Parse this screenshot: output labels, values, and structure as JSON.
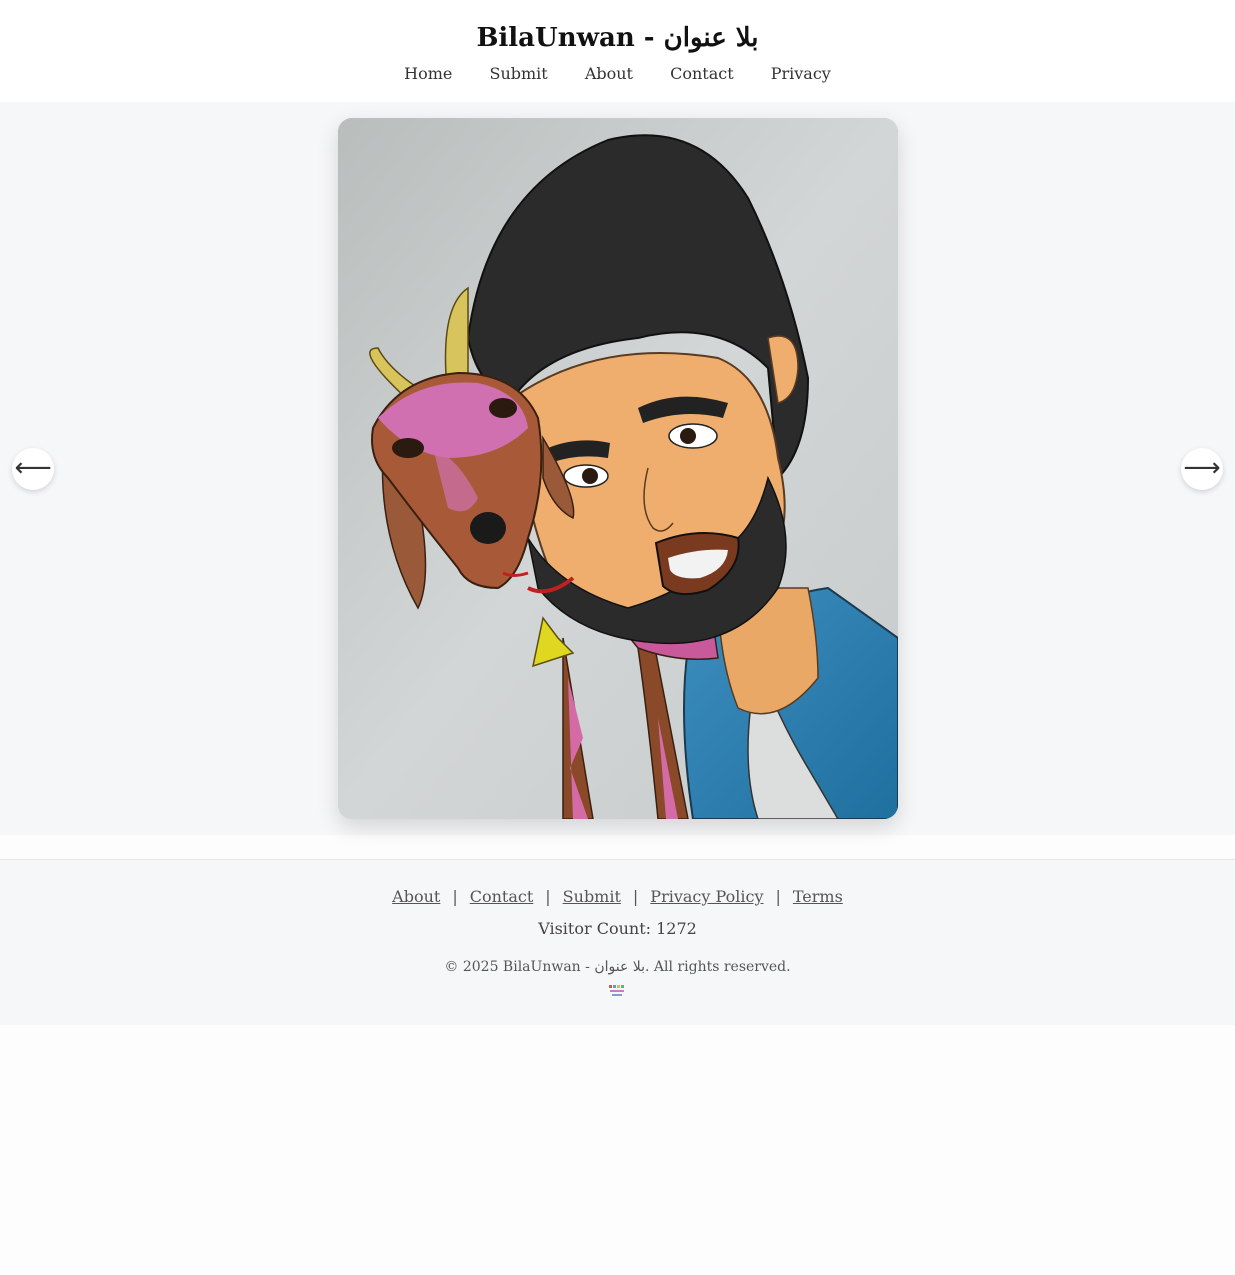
{
  "header": {
    "title": "BilaUnwan - بلا عنوان",
    "nav": [
      "Home",
      "Submit",
      "About",
      "Contact",
      "Privacy"
    ]
  },
  "slider": {
    "prev_icon": "arrow-left-icon",
    "next_icon": "arrow-right-icon",
    "prev_glyph": "⟵",
    "next_glyph": "⟶",
    "image_subject": "colored pencil drawing of a bearded man with a goat"
  },
  "footer": {
    "links": [
      "About",
      "Contact",
      "Submit",
      "Privacy Policy",
      "Terms"
    ],
    "separator": "|",
    "visitor_count": "Visitor Count: 1272",
    "copyright": "© 2025 BilaUnwan - بلا عنوان. All rights reserved.",
    "badge_icon": "site-logo-badge-icon"
  }
}
